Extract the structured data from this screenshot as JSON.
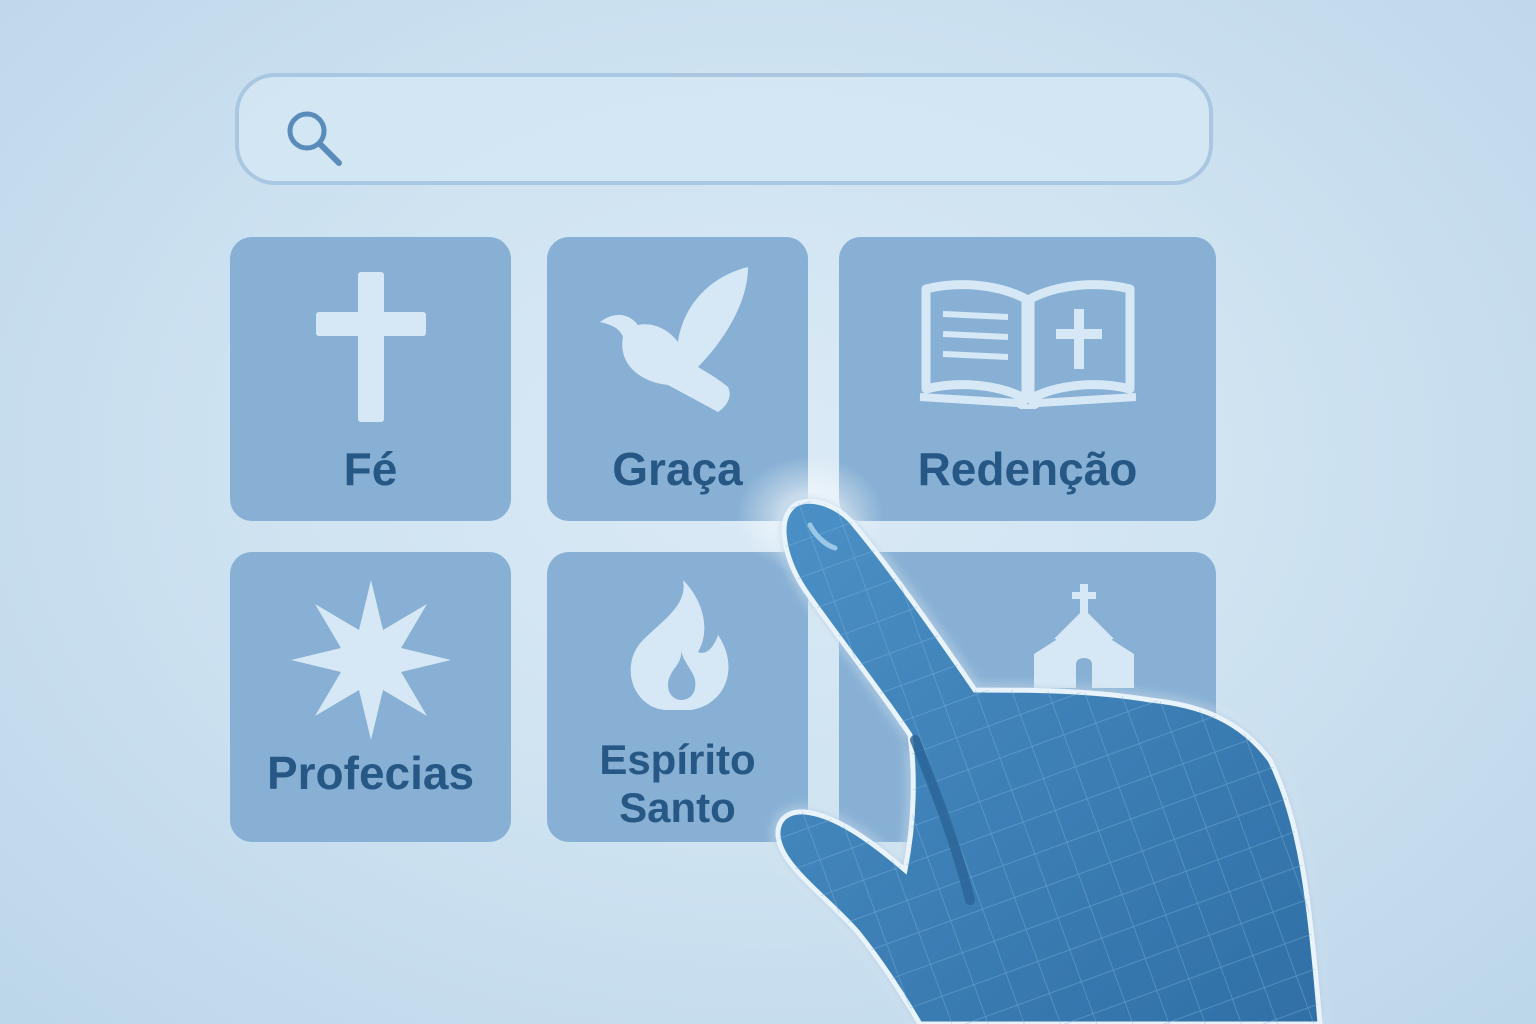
{
  "search": {
    "value": "",
    "placeholder": "",
    "icon": "search-icon"
  },
  "tiles": [
    {
      "label": "Fé",
      "icon": "cross-icon"
    },
    {
      "label": "Graça",
      "icon": "dove-icon"
    },
    {
      "label": "Redenção",
      "icon": "open-bible-icon"
    },
    {
      "label": "Profecias",
      "icon": "star-icon"
    },
    {
      "label": "Espírito Santo",
      "label_line1": "Espírito",
      "label_line2": "Santo",
      "icon": "flame-icon"
    },
    {
      "label": "",
      "icon": "church-icon"
    }
  ],
  "colors": {
    "background": "#cfe3f1",
    "tile": "#87b0d4",
    "tile_text": "#275784",
    "icon_light": "#d6e8f5",
    "hand": "#3a7fb8",
    "search_border": "#a9c7e0"
  }
}
